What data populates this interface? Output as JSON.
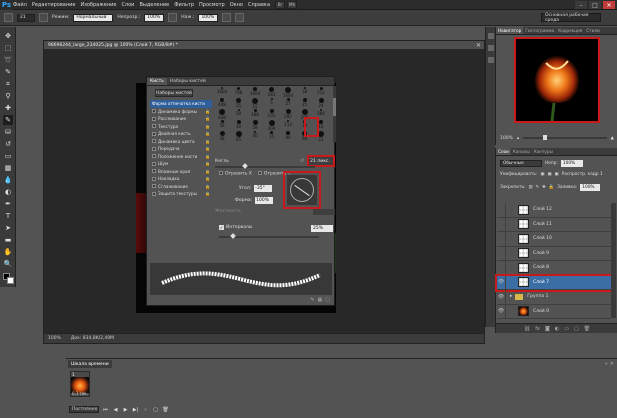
{
  "app": {
    "logo": "Ps",
    "menu": [
      "Файл",
      "Редактирование",
      "Изображение",
      "Слои",
      "Выделение",
      "Фильтр",
      "Просмотр",
      "Окно",
      "Справка"
    ],
    "menu_buttons": [
      "Br",
      "Mb"
    ],
    "window_buttons": [
      "–",
      "□",
      "✕"
    ]
  },
  "options_bar": {
    "brush_size": "21",
    "mode_label": "Режим:",
    "mode_value": "Нормальный",
    "opacity_label": "Непрозр.:",
    "opacity_value": "100%",
    "flow_label": "Наж.:",
    "flow_value": "100%",
    "workspace": "Основная рабочая среда"
  },
  "document": {
    "title": "98696244_large_234025.jpg @ 100% (Слой 7, RGB/8#) *",
    "zoom": "100%",
    "doc_info": "Док: 834,8K/2,49M"
  },
  "brush_panel": {
    "tabs": [
      "Кисть",
      "Наборы кистей"
    ],
    "presets_button": "Наборы кистей",
    "options": [
      {
        "label": "Форма отпечатка кисти",
        "selected": true,
        "checkable": false
      },
      {
        "label": "Динамика формы",
        "selected": false,
        "checkable": true
      },
      {
        "label": "Рассеивание",
        "selected": false,
        "checkable": true
      },
      {
        "label": "Текстура",
        "selected": false,
        "checkable": true
      },
      {
        "label": "Двойная кисть",
        "selected": false,
        "checkable": true
      },
      {
        "label": "Динамика цвета",
        "selected": false,
        "checkable": true
      },
      {
        "label": "Передача",
        "selected": false,
        "checkable": true
      },
      {
        "label": "Положение кисти",
        "selected": false,
        "checkable": true
      },
      {
        "label": "Шум",
        "selected": false,
        "checkable": true
      },
      {
        "label": "Влажные края",
        "selected": false,
        "checkable": true
      },
      {
        "label": "Накладка",
        "selected": false,
        "checkable": true
      },
      {
        "label": "Сглаживание",
        "selected": false,
        "checkable": true
      },
      {
        "label": "Защита текстуры",
        "selected": false,
        "checkable": true
      }
    ],
    "tips": [
      "1604",
      "748",
      "1604",
      "245",
      "1604",
      "38",
      "512",
      "448",
      "25",
      "15",
      "5",
      "27",
      "25",
      "24",
      "448",
      "58",
      "488",
      "101",
      "292",
      "296",
      "366",
      "56",
      "30",
      "59",
      "304",
      "113",
      "38",
      "15",
      "38",
      "65",
      "40",
      "35",
      "90",
      "98",
      "21"
    ],
    "size_label": "Кегль",
    "size_value": "21 пикс.",
    "flip_x": "Отразить X",
    "flip_y": "Отразить Y",
    "angle_label": "Угол:",
    "angle_value": "-35°",
    "roundness_label": "Форма:",
    "roundness_value": "100%",
    "hardness_label": "Жесткость",
    "spacing_label": "Интервалы",
    "spacing_value": "25%"
  },
  "navigator": {
    "tabs": [
      "Навигатор",
      "Гистограмма",
      "Коррекция",
      "Стили"
    ],
    "zoom": "100%"
  },
  "layers": {
    "tabs": [
      "Слои",
      "Каналы",
      "Контуры"
    ],
    "blend_mode": "Обычные",
    "opacity_label": "Непр:",
    "opacity_value": "100%",
    "unify_label": "Унифицировать:",
    "propagate_label": "Распростр. кадр 1",
    "lock_label": "Закрепить:",
    "fill_label": "Заливка:",
    "fill_value": "100%",
    "items": [
      {
        "name": "Слой 12",
        "type": "layer",
        "visible": false,
        "active": false
      },
      {
        "name": "Слой 11",
        "type": "layer",
        "visible": false,
        "active": false
      },
      {
        "name": "Слой 10",
        "type": "layer",
        "visible": false,
        "active": false
      },
      {
        "name": "Слой 9",
        "type": "layer",
        "visible": false,
        "active": false
      },
      {
        "name": "Слой 8",
        "type": "layer",
        "visible": false,
        "active": false
      },
      {
        "name": "Слой 7",
        "type": "layer",
        "visible": true,
        "active": true
      },
      {
        "name": "Группа 1",
        "type": "group",
        "visible": true,
        "active": false
      },
      {
        "name": "Слой 0",
        "type": "photo",
        "visible": true,
        "active": false
      }
    ]
  },
  "timeline": {
    "title": "Шкала времени",
    "frame_number": "1",
    "frame_duration": "0,1 сек.",
    "loop": "Постоянно"
  },
  "colors": {
    "highlight_red": "#c8191b",
    "selection_blue": "#3b6ea5"
  }
}
